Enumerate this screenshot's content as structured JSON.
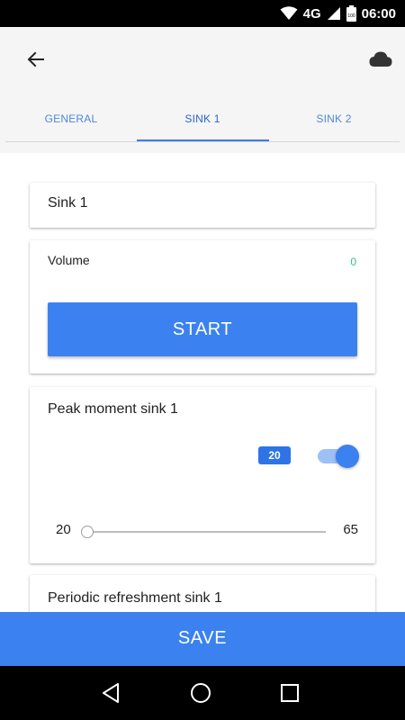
{
  "status_bar": {
    "network": "4G",
    "battery": "100",
    "time": "06:00",
    "icons": [
      "wifi-icon",
      "signal-icon",
      "battery-icon"
    ]
  },
  "app_bar": {
    "back_icon": "arrow-left-icon",
    "cloud_icon": "cloud-icon"
  },
  "tabs": [
    {
      "label": "GENERAL",
      "active": false
    },
    {
      "label": "SINK 1",
      "active": true
    },
    {
      "label": "SINK 2",
      "active": false
    }
  ],
  "cards": {
    "name": {
      "value": "Sink 1"
    },
    "volume": {
      "label": "Volume",
      "value": "0",
      "button_label": "START"
    },
    "peak": {
      "title": "Peak moment sink 1",
      "badge": "20",
      "toggle_on": true,
      "slider_min": "20",
      "slider_max": "65",
      "slider_value": 20
    },
    "refresh": {
      "title": "Periodic refreshment sink 1"
    }
  },
  "save_label": "SAVE",
  "nav_bar": {
    "icons": [
      "back-triangle-icon",
      "home-circle-icon",
      "recents-square-icon"
    ]
  },
  "colors": {
    "accent": "#3b82f0",
    "tab_text": "#4e88d8",
    "volume_value": "#2ec27e",
    "toggle_track": "#9dc0f7"
  }
}
